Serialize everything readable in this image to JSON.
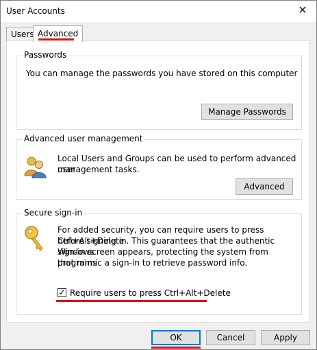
{
  "window": {
    "title": "User Accounts"
  },
  "tabs": [
    {
      "label": "Users",
      "active": false
    },
    {
      "label": "Advanced",
      "active": true
    }
  ],
  "passwords": {
    "title": "Passwords",
    "description": "You can manage the passwords you have stored on this computer",
    "button": "Manage Passwords"
  },
  "advanced": {
    "title": "Advanced user management",
    "description_line1": "Local Users and Groups can be used to perform advanced user",
    "description_line2": "management tasks.",
    "button": "Advanced"
  },
  "secure": {
    "title": "Secure sign-in",
    "lines": [
      "For added security, you can require users to press Ctrl+Alt+Delete",
      "before signing in. This guarantees that the authentic Windows",
      "sign-in screen appears, protecting the system from programs",
      "that mimic a sign-in to retrieve password info."
    ],
    "checkbox_label": "Require users to press Ctrl+Alt+Delete",
    "checkbox_checked": true
  },
  "footer": {
    "ok": "OK",
    "cancel": "Cancel",
    "apply": "Apply"
  },
  "colors": {
    "highlight": "#e01010",
    "focus": "#0078d7"
  }
}
